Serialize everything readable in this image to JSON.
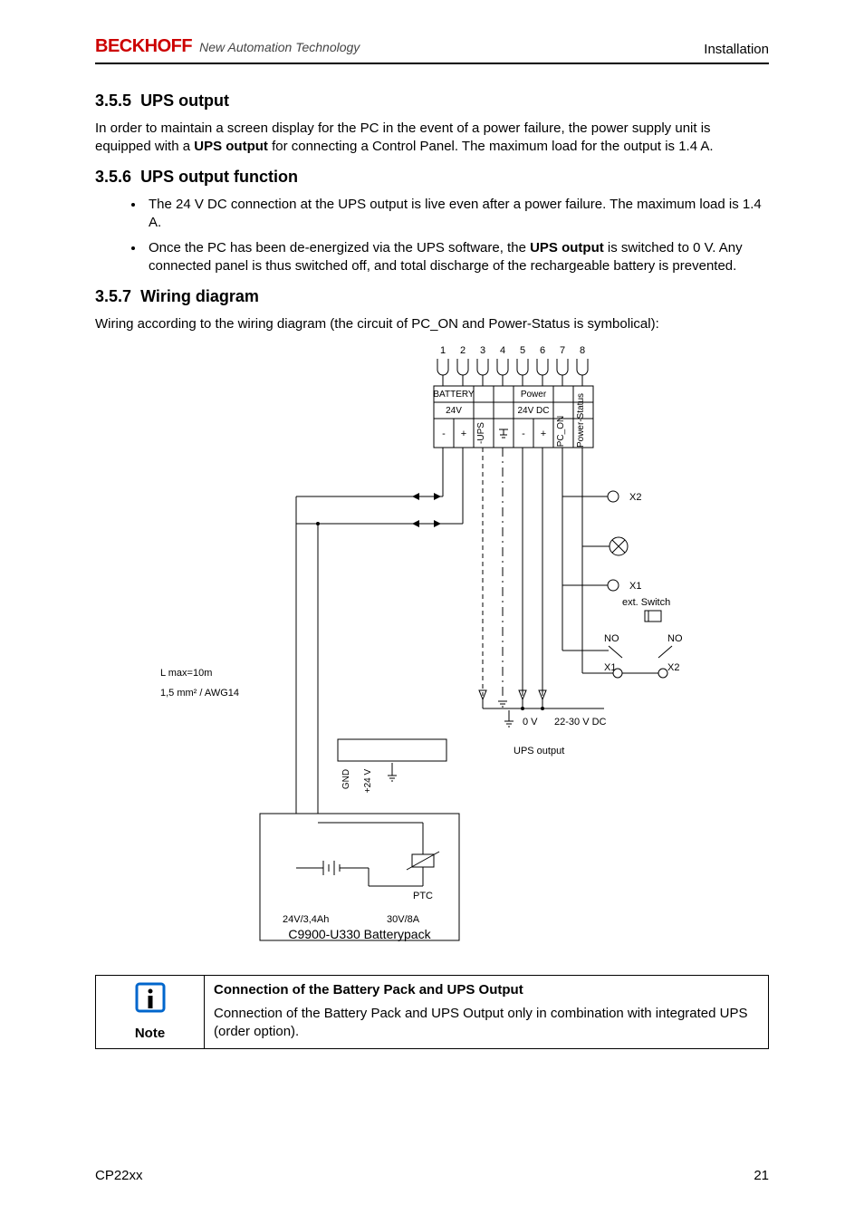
{
  "header": {
    "logo_main": "BECKHOFF",
    "logo_tagline": "New Automation Technology",
    "section": "Installation"
  },
  "sections": {
    "s355": {
      "number": "3.5.5",
      "title": "UPS output",
      "para_a": "In order to maintain a screen display for the PC in the event of a power failure, the power supply unit is equipped with a ",
      "para_bold": "UPS output",
      "para_b": " for connecting a Control Panel. The maximum load for the output is 1.4 A."
    },
    "s356": {
      "number": "3.5.6",
      "title": "UPS output function",
      "bullet1": "The 24 V DC connection at the UPS output is live even after a power failure. The maximum load is 1.4 A.",
      "bullet2a": "Once the PC has been de-energized via the UPS software, the ",
      "bullet2bold": "UPS output",
      "bullet2b": " is switched to 0 V. Any connected panel is thus switched off, and total discharge of the rechargeable battery is prevented."
    },
    "s357": {
      "number": "3.5.7",
      "title": "Wiring diagram",
      "para": "Wiring according to the wiring diagram (the circuit of PC_ON and Power-Status is symbolical):"
    }
  },
  "diagram": {
    "terminal_nums": [
      "1",
      "2",
      "3",
      "4",
      "5",
      "6",
      "7",
      "8"
    ],
    "battery_label": "BATTERY",
    "battery_volt": "24V",
    "power_label": "Power",
    "power_volt": "24V DC",
    "ups_minus_label": "-UPS",
    "pc_on_label": "PC_ON",
    "power_status_label": "Power-Status",
    "earth_symbol": "⏚",
    "minus": "-",
    "plus": "+",
    "x1": "X1",
    "x2": "X2",
    "ext_switch": "ext. Switch",
    "no": "NO",
    "lmax": "L max=10m",
    "wire_gauge": "1,5 mm² / AWG14",
    "zero_v": "0 V",
    "v_range": "22-30 V DC",
    "ups_output": "UPS output",
    "gnd": "GND",
    "p24v": "+24 V",
    "ptc": "PTC",
    "batt_spec1": "24V/3,4Ah",
    "batt_spec2": "30V/8A",
    "batterypack": "C9900-U330 Batterypack",
    "conn_nums": [
      "1",
      "2"
    ]
  },
  "note": {
    "label": "Note",
    "title": "Connection of the Battery Pack and UPS Output",
    "body": "Connection of the Battery Pack and UPS Output only in combination with integrated UPS (order option)."
  },
  "footer": {
    "product": "CP22xx",
    "page": "21"
  }
}
